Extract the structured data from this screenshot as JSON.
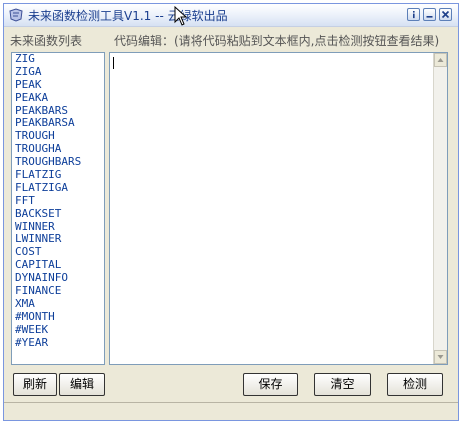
{
  "window": {
    "title": "未来函数检测工具V1.1 -- 云绿软出品"
  },
  "function_list": {
    "label": "未来函数列表",
    "items": [
      "ZIG",
      "ZIGA",
      "PEAK",
      "PEAKA",
      "PEAKBARS",
      "PEAKBARSA",
      "TROUGH",
      "TROUGHA",
      "TROUGHBARS",
      "FLATZIG",
      "FLATZIGA",
      "FFT",
      "BACKSET",
      "WINNER",
      "LWINNER",
      "COST",
      "CAPITAL",
      "DYNAINFO",
      "FINANCE",
      "XMA",
      "#MONTH",
      "#WEEK",
      "#YEAR"
    ]
  },
  "editor": {
    "label": "代码编辑：(请将代码粘贴到文本框内,点击检测按钮查看结果)",
    "value": ""
  },
  "buttons": {
    "refresh": "刷新",
    "edit": "编辑",
    "save": "保存",
    "clear": "清空",
    "check": "检测"
  },
  "icons": {
    "app": "app-icon",
    "info": "info-icon",
    "minimize": "minimize-icon",
    "close": "close-icon",
    "cursor": "cursor-icon"
  },
  "colors": {
    "title_text": "#1b3f8f",
    "list_text": "#0e3f9a",
    "window_bg": "#ece9d8"
  }
}
